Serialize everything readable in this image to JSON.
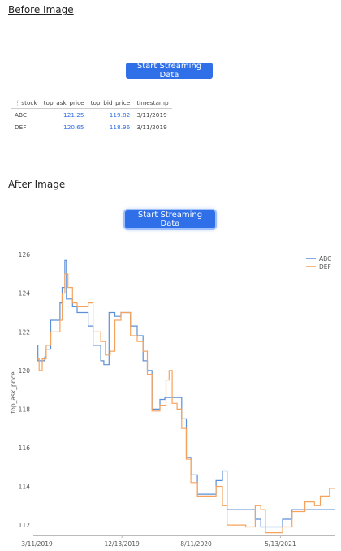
{
  "before": {
    "heading": "Before Image",
    "button_label": "Start Streaming Data",
    "table": {
      "columns": [
        "stock",
        "top_ask_price",
        "top_bid_price",
        "timestamp"
      ],
      "rows": [
        [
          "ABC",
          "121.25",
          "119.82",
          "3/11/2019"
        ],
        [
          "DEF",
          "120.65",
          "118.96",
          "3/11/2019"
        ]
      ]
    }
  },
  "after": {
    "heading": "After Image",
    "button_label": "Start Streaming Data"
  },
  "colors": {
    "button": "#2f6fe8",
    "abc": "#5b8fd6",
    "def": "#f5a35c"
  },
  "chart_data": {
    "type": "line",
    "title": "",
    "xlabel": "",
    "ylabel": "top_ask_price",
    "ylim": [
      111.5,
      126.3
    ],
    "yticks": [
      112,
      114,
      116,
      118,
      120,
      122,
      124,
      126
    ],
    "xticks": [
      "3/11/2019",
      "12/13/2019",
      "8/11/2020",
      "5/13/2021"
    ],
    "x_tick_dates": [
      "2019-03-11",
      "2019-12-13",
      "2020-08-11",
      "2021-05-13"
    ],
    "xlim": [
      "2019-02-27",
      "2021-11-08"
    ],
    "legend": "top-right",
    "grid": false,
    "series": [
      {
        "name": "ABC",
        "points": [
          [
            "2019-03-11",
            121.3
          ],
          [
            "2019-03-14",
            120.5
          ],
          [
            "2019-04-05",
            120.7
          ],
          [
            "2019-04-10",
            121.1
          ],
          [
            "2019-04-25",
            122.6
          ],
          [
            "2019-05-25",
            123.5
          ],
          [
            "2019-06-01",
            124.3
          ],
          [
            "2019-06-10",
            125.7
          ],
          [
            "2019-06-15",
            123.7
          ],
          [
            "2019-07-05",
            123.3
          ],
          [
            "2019-07-20",
            123.0
          ],
          [
            "2019-08-25",
            122.3
          ],
          [
            "2019-09-10",
            121.3
          ],
          [
            "2019-10-05",
            120.5
          ],
          [
            "2019-10-15",
            120.3
          ],
          [
            "2019-11-01",
            123.0
          ],
          [
            "2019-11-20",
            122.8
          ],
          [
            "2019-12-10",
            123.0
          ],
          [
            "2020-01-10",
            122.3
          ],
          [
            "2020-02-01",
            121.8
          ],
          [
            "2020-02-20",
            120.5
          ],
          [
            "2020-03-05",
            120.0
          ],
          [
            "2020-03-20",
            118.0
          ],
          [
            "2020-04-15",
            118.5
          ],
          [
            "2020-05-01",
            118.6
          ],
          [
            "2020-06-10",
            118.6
          ],
          [
            "2020-06-25",
            117.5
          ],
          [
            "2020-07-10",
            115.5
          ],
          [
            "2020-07-25",
            114.6
          ],
          [
            "2020-08-15",
            113.6
          ],
          [
            "2020-09-25",
            113.6
          ],
          [
            "2020-10-15",
            114.3
          ],
          [
            "2020-11-05",
            114.8
          ],
          [
            "2020-11-20",
            112.8
          ],
          [
            "2021-01-20",
            112.8
          ],
          [
            "2021-02-20",
            112.3
          ],
          [
            "2021-03-10",
            111.9
          ],
          [
            "2021-05-01",
            111.9
          ],
          [
            "2021-05-20",
            112.3
          ],
          [
            "2021-06-20",
            112.8
          ],
          [
            "2021-11-08",
            112.8
          ]
        ]
      },
      {
        "name": "DEF",
        "points": [
          [
            "2019-03-11",
            120.6
          ],
          [
            "2019-03-18",
            120.0
          ],
          [
            "2019-03-28",
            120.6
          ],
          [
            "2019-04-10",
            121.3
          ],
          [
            "2019-04-25",
            122.0
          ],
          [
            "2019-05-25",
            122.6
          ],
          [
            "2019-06-01",
            124.0
          ],
          [
            "2019-06-10",
            125.0
          ],
          [
            "2019-06-20",
            124.3
          ],
          [
            "2019-07-05",
            123.5
          ],
          [
            "2019-07-20",
            123.3
          ],
          [
            "2019-08-25",
            123.5
          ],
          [
            "2019-09-10",
            122.0
          ],
          [
            "2019-10-05",
            121.5
          ],
          [
            "2019-10-20",
            120.8
          ],
          [
            "2019-11-05",
            121.0
          ],
          [
            "2019-11-20",
            122.6
          ],
          [
            "2019-12-10",
            123.0
          ],
          [
            "2020-01-10",
            121.8
          ],
          [
            "2020-02-01",
            121.5
          ],
          [
            "2020-02-20",
            121.0
          ],
          [
            "2020-03-05",
            119.8
          ],
          [
            "2020-03-20",
            117.9
          ],
          [
            "2020-04-15",
            118.2
          ],
          [
            "2020-05-05",
            119.5
          ],
          [
            "2020-05-15",
            120.0
          ],
          [
            "2020-05-25",
            118.3
          ],
          [
            "2020-06-10",
            118.0
          ],
          [
            "2020-06-25",
            117.0
          ],
          [
            "2020-07-10",
            115.4
          ],
          [
            "2020-07-25",
            114.2
          ],
          [
            "2020-08-15",
            113.5
          ],
          [
            "2020-09-25",
            113.5
          ],
          [
            "2020-10-15",
            114.0
          ],
          [
            "2020-11-05",
            113.0
          ],
          [
            "2020-11-20",
            112.0
          ],
          [
            "2021-01-20",
            111.9
          ],
          [
            "2021-02-20",
            113.0
          ],
          [
            "2021-03-10",
            112.8
          ],
          [
            "2021-03-25",
            111.6
          ],
          [
            "2021-05-01",
            111.6
          ],
          [
            "2021-05-20",
            111.9
          ],
          [
            "2021-06-20",
            112.7
          ],
          [
            "2021-08-01",
            113.2
          ],
          [
            "2021-09-01",
            113.0
          ],
          [
            "2021-09-20",
            113.5
          ],
          [
            "2021-10-20",
            113.9
          ],
          [
            "2021-11-08",
            113.9
          ]
        ]
      }
    ]
  }
}
